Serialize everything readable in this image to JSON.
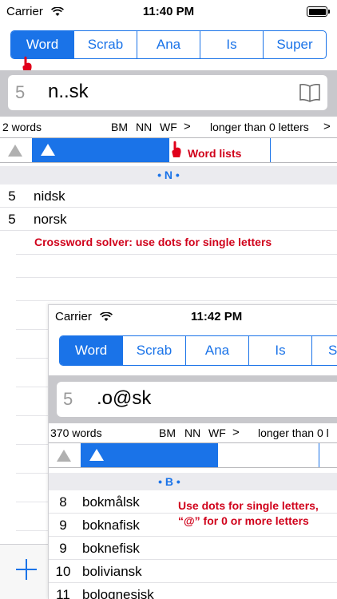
{
  "back": {
    "status": {
      "carrier": "Carrier",
      "time": "11:40 PM"
    },
    "segments": [
      "Word",
      "Scrab",
      "Ana",
      "Is",
      "Super"
    ],
    "search": {
      "length": "5",
      "query": "n..sk"
    },
    "meta": {
      "count": "2 words",
      "bm": "BM",
      "nn": "NN",
      "wf": "WF",
      "chev": ">",
      "longer": "longer than 0 letters",
      "chev2": ">"
    },
    "section": "• N •",
    "rows": [
      {
        "n": "5",
        "word": "nidsk"
      },
      {
        "n": "5",
        "word": "norsk"
      }
    ]
  },
  "front": {
    "status": {
      "carrier": "Carrier",
      "time": "11:42 PM"
    },
    "segments": [
      "Word",
      "Scrab",
      "Ana",
      "Is",
      "Su"
    ],
    "search": {
      "length": "5",
      "query": ".o@sk"
    },
    "meta": {
      "count": "370 words",
      "bm": "BM",
      "nn": "NN",
      "wf": "WF",
      "chev": ">",
      "longer": "longer than 0 l"
    },
    "section": "• B •",
    "rows": [
      {
        "n": "8",
        "word": "bokmålsk"
      },
      {
        "n": "9",
        "word": "boknafisk"
      },
      {
        "n": "9",
        "word": "boknefisk"
      },
      {
        "n": "10",
        "word": "boliviansk"
      },
      {
        "n": "11",
        "word": "bolognesisk"
      }
    ]
  },
  "annotations": {
    "word_lists": "Word lists",
    "crossword": "Crossword solver: use dots for single letters",
    "dots_line1": "Use dots for single letters,",
    "dots_line2": "“@” for 0 or more letters"
  },
  "colors": {
    "accent": "#1a73e8",
    "annotation": "#d0021b"
  },
  "icons": [
    "wifi-icon",
    "battery-icon",
    "book-icon",
    "pointing-hand-icon",
    "plus-icon",
    "sort-triangle-icon",
    "chevron-right-icon"
  ]
}
